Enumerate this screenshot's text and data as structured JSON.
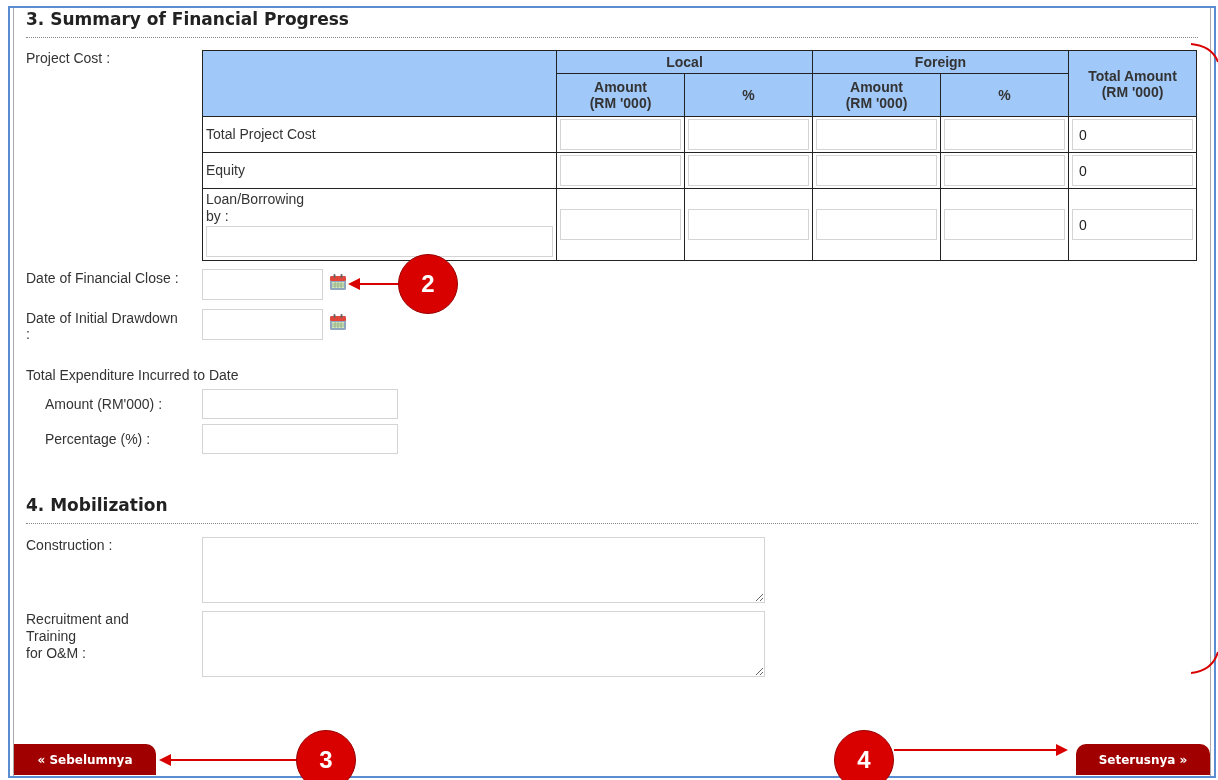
{
  "financial_progress": {
    "title": "3. Summary of Financial Progress",
    "project_cost_label": "Project Cost :",
    "table": {
      "groups": [
        {
          "label": "Local"
        },
        {
          "label": "Foreign"
        }
      ],
      "sub_headers": [
        {
          "label": "Amount\n(RM '000)"
        },
        {
          "label": "%"
        },
        {
          "label": "Amount\n(RM '000)"
        },
        {
          "label": "%"
        }
      ],
      "total_header": "Total Amount\n(RM '000)",
      "rows": [
        {
          "label": "Total Project Cost",
          "kind": "plain",
          "total": "0"
        },
        {
          "label": "Equity",
          "kind": "plain",
          "total": "0"
        },
        {
          "label": "Loan/Borrowing\nby :",
          "kind": "with-field",
          "total": "0"
        }
      ]
    },
    "date_fields": [
      {
        "label": "Date of Financial Close :"
      },
      {
        "label": "Date of Initial Drawdown\n:"
      }
    ],
    "expenditure": {
      "title": "Total Expenditure Incurred to Date",
      "fields": [
        {
          "label": "Amount (RM'000) :"
        },
        {
          "label": "Percentage (%) :"
        }
      ]
    }
  },
  "mobilization": {
    "title": "4. Mobilization",
    "fields": [
      {
        "label": "Construction :"
      },
      {
        "label": "Recruitment and\nTraining\nfor O&M :"
      }
    ]
  },
  "buttons": [
    {
      "label": "« Sebelumnya"
    },
    {
      "label": "Seterusnya »"
    }
  ],
  "annotations": [
    {
      "number": "2"
    },
    {
      "number": "3"
    },
    {
      "number": "4"
    }
  ]
}
